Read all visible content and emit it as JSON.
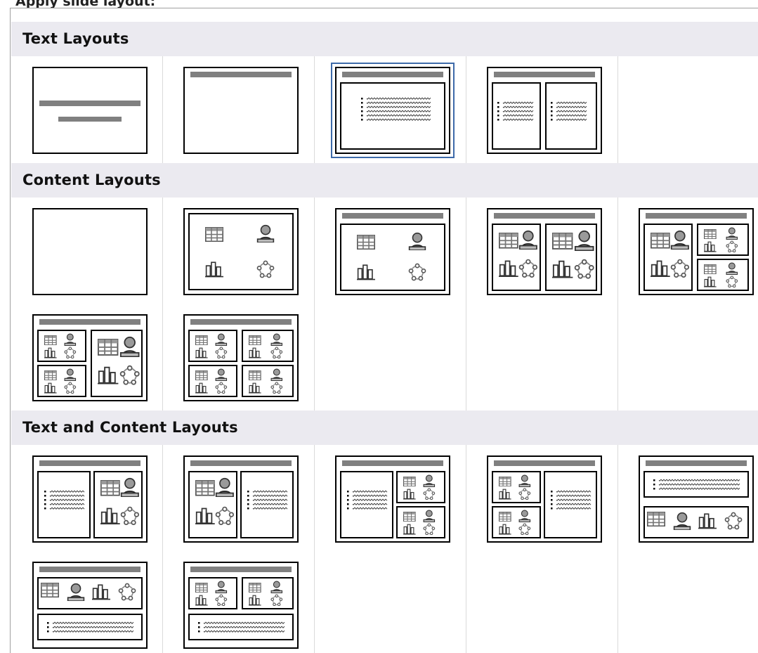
{
  "pane": {
    "caption": "Apply slide layout:"
  },
  "sections": {
    "text": {
      "title": "Text Layouts"
    },
    "content": {
      "title": "Content Layouts"
    },
    "textContent": {
      "title": "Text and Content Layouts"
    }
  },
  "layouts": {
    "text": [
      "title-slide",
      "title-only",
      "title-content",
      "title-two-content"
    ],
    "content": [
      "blank",
      "centered-content",
      "title-content-objects",
      "title-two-objects",
      "title-object-and-two-objects",
      "title-two-objects-and-object",
      "title-four-objects"
    ],
    "textContent": [
      "title-text-and-content",
      "title-content-and-text",
      "title-text-and-two-contents",
      "title-two-contents-and-text",
      "title-text-over-content",
      "title-content-over-text",
      "title-two-contents-over-text"
    ]
  },
  "selected": "text.2",
  "colors": {
    "selection": "#3d6aa9",
    "header": "#ebeaf0",
    "placeholder": "#808080"
  },
  "icons": {
    "table": "table-icon",
    "clipart": "clipart-icon",
    "chart": "chart-icon",
    "diagram": "diagram-icon",
    "bullets": "bullet-list-icon"
  }
}
